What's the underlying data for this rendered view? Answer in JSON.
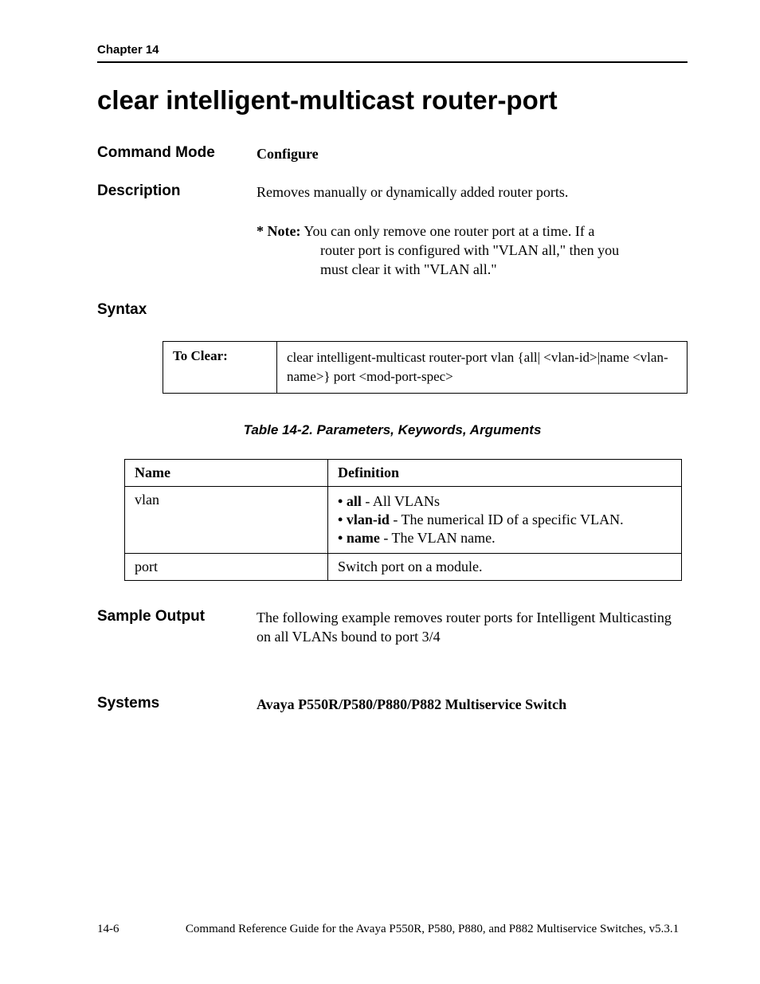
{
  "header": {
    "chapter": "Chapter 14"
  },
  "title": "clear intelligent-multicast router-port",
  "sections": {
    "command_mode": {
      "label": "Command Mode",
      "value": "Configure"
    },
    "description": {
      "label": "Description",
      "value": "Removes manually or dynamically added router ports."
    },
    "note": {
      "label": "* Note:",
      "text_first": "You can only remove one router port at a time. If a",
      "text_rest1": "router port is configured with \"VLAN all,\" then you",
      "text_rest2": "must clear it with \"VLAN all.\""
    },
    "syntax": {
      "label": "Syntax",
      "box_label": "To Clear:",
      "box_text": "clear intelligent-multicast router-port vlan {all| <vlan-id>|name <vlan-name>} port <mod-port-spec>"
    },
    "table": {
      "caption": "Table 14-2.  Parameters, Keywords, Arguments",
      "head_name": "Name",
      "head_def": "Definition",
      "rows": [
        {
          "name": "vlan",
          "bullets": [
            {
              "b": "all",
              "rest": " - All VLANs"
            },
            {
              "b": "vlan-id",
              "rest": " - The numerical ID of a specific VLAN."
            },
            {
              "b": "name",
              "rest": " - The VLAN name."
            }
          ]
        },
        {
          "name": "port",
          "plain": "Switch port on a module."
        }
      ]
    },
    "sample_output": {
      "label": "Sample Output",
      "value": "The following example removes router ports for Intelligent Multicasting on all VLANs bound to port 3/4"
    },
    "systems": {
      "label": "Systems",
      "value": "Avaya P550R/P580/P880/P882 Multiservice Switch"
    }
  },
  "footer": {
    "pagenum": "14-6",
    "text": "Command Reference Guide for the Avaya P550R, P580, P880, and P882 Multiservice Switches, v5.3.1"
  }
}
